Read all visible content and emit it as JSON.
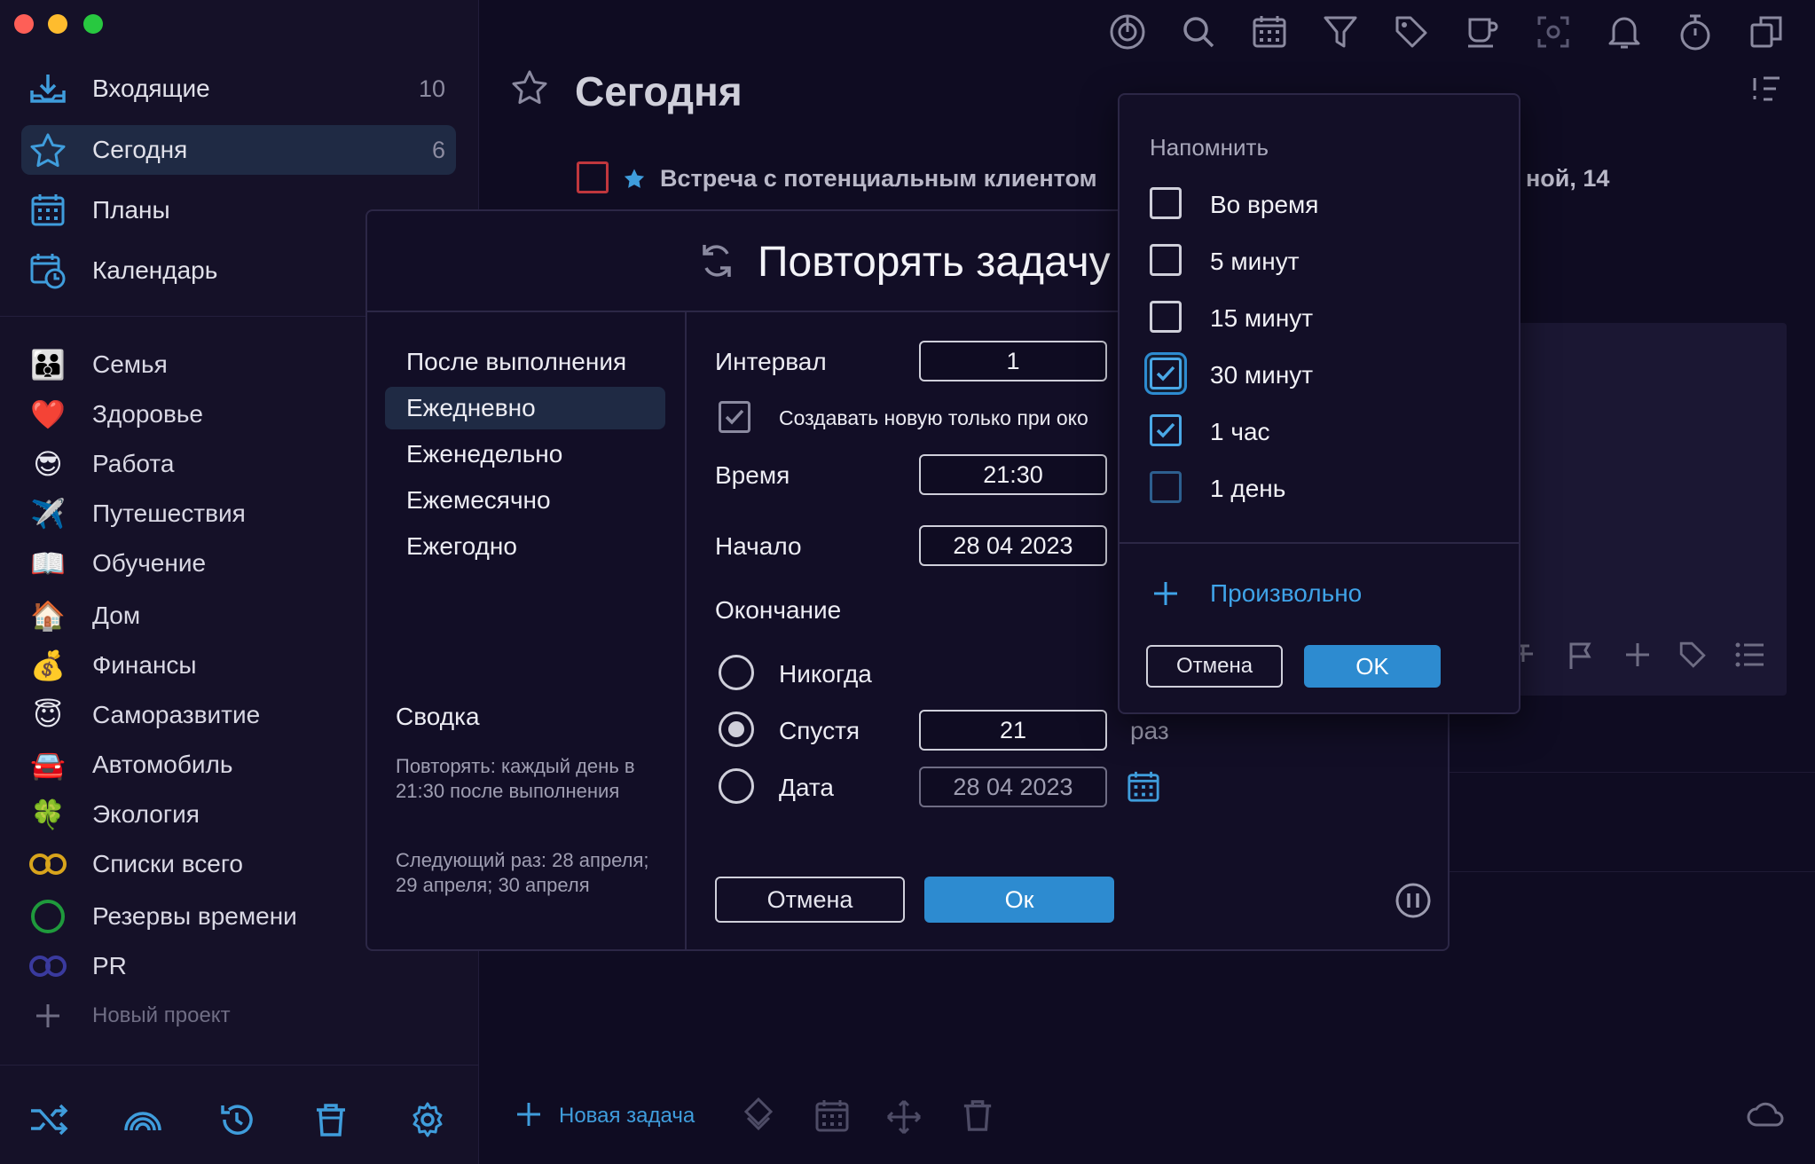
{
  "sidebar": {
    "nav": [
      {
        "label": "Входящие",
        "count": "10",
        "icon": "inbox-icon"
      },
      {
        "label": "Сегодня",
        "count": "6",
        "icon": "star-icon",
        "active": true
      },
      {
        "label": "Планы",
        "count": "",
        "icon": "calendar-grid-icon"
      },
      {
        "label": "Календарь",
        "count": "",
        "icon": "calendar-clock-icon"
      }
    ],
    "projects": [
      {
        "label": "Семья",
        "icon": "👪"
      },
      {
        "label": "Здоровье",
        "icon": "❤️"
      },
      {
        "label": "Работа",
        "icon": "😎"
      },
      {
        "label": "Путешествия",
        "icon": "✈️"
      },
      {
        "label": "Обучение",
        "icon": "📖"
      },
      {
        "label": "Дом",
        "icon": "🏠"
      },
      {
        "label": "Финансы",
        "icon": "💰"
      },
      {
        "label": "Саморазвитие",
        "icon": "😇"
      },
      {
        "label": "Автомобиль",
        "icon": "🚘"
      },
      {
        "label": "Экология",
        "icon": "🍀"
      },
      {
        "label": "Списки всего",
        "icon": "infinity-icon"
      },
      {
        "label": "Резервы времени",
        "icon": "ring-icon"
      },
      {
        "label": "PR",
        "icon": "infinity-icon"
      }
    ],
    "new_project": "Новый проект"
  },
  "main": {
    "title": "Сегодня",
    "task_text": "Встреча с потенциальным клиентом",
    "task_text_tail": "ной, 14",
    "bottom": {
      "new_task": "Новая задача"
    }
  },
  "repeat_dialog": {
    "title": "Повторять задачу",
    "frequencies": [
      "После выполнения",
      "Ежедневно",
      "Еженедельно",
      "Ежемесячно",
      "Ежегодно"
    ],
    "active_frequency": "Ежедневно",
    "interval_label": "Интервал",
    "interval_value": "1",
    "create_new_label": "Создавать новую только при око",
    "time_label": "Время",
    "time_value": "21:30",
    "start_label": "Начало",
    "start_value": "28 04 2023",
    "end_label": "Окончание",
    "end_options": {
      "never": "Никогда",
      "after": "Спустя",
      "after_value": "21",
      "after_unit": "раз",
      "date": "Дата",
      "date_value": "28 04 2023"
    },
    "summary_title": "Сводка",
    "summary_text": "Повторять: каждый день в 21:30 после выполнения",
    "next_text": "Следующий раз: 28 апреля; 29 апреля; 30 апреля",
    "cancel": "Отмена",
    "ok": "Ок"
  },
  "reminder": {
    "title": "Напомнить",
    "options": [
      {
        "label": "Во время",
        "checked": false
      },
      {
        "label": "5 минут",
        "checked": false
      },
      {
        "label": "15 минут",
        "checked": false
      },
      {
        "label": "30 минут",
        "checked": true
      },
      {
        "label": "1 час",
        "checked": true
      },
      {
        "label": "1 день",
        "checked": false
      }
    ],
    "custom": "Произвольно",
    "cancel": "Отмена",
    "ok": "OK"
  },
  "colors": {
    "accent": "#2d8bd0",
    "link": "#3fa3e8",
    "bg": "#0f0c22",
    "sidebar": "#151128",
    "task_checkbox": "#c0373d"
  }
}
